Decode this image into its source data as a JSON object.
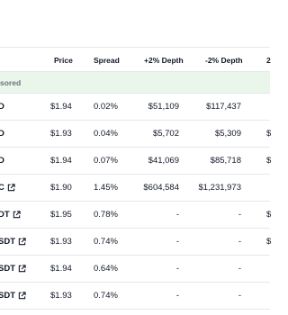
{
  "table": {
    "headers": {
      "price": "Price",
      "spread": "Spread",
      "depth_plus": "+2% Depth",
      "depth_minus": "-2% Depth",
      "cut": "2"
    },
    "sponsored_label": "sored",
    "rows": [
      {
        "pair": "D",
        "link": false,
        "price": "$1.94",
        "spread": "0.02%",
        "depth_plus": "$51,109",
        "depth_minus": "$117,437",
        "cut": ""
      },
      {
        "pair": "D",
        "link": false,
        "price": "$1.93",
        "spread": "0.04%",
        "depth_plus": "$5,702",
        "depth_minus": "$5,309",
        "cut": "$"
      },
      {
        "pair": "D",
        "link": false,
        "price": "$1.94",
        "spread": "0.07%",
        "depth_plus": "$41,069",
        "depth_minus": "$85,718",
        "cut": "$"
      },
      {
        "pair": "C",
        "link": true,
        "price": "$1.90",
        "spread": "1.45%",
        "depth_plus": "$604,584",
        "depth_minus": "$1,231,973",
        "cut": ""
      },
      {
        "pair": "DT",
        "link": true,
        "price": "$1.95",
        "spread": "0.78%",
        "depth_plus": "-",
        "depth_minus": "-",
        "cut": "$"
      },
      {
        "pair": "SDT",
        "link": true,
        "price": "$1.93",
        "spread": "0.74%",
        "depth_plus": "-",
        "depth_minus": "-",
        "cut": "$"
      },
      {
        "pair": "SDT",
        "link": true,
        "price": "$1.94",
        "spread": "0.64%",
        "depth_plus": "-",
        "depth_minus": "-",
        "cut": ""
      },
      {
        "pair": "SDT",
        "link": true,
        "price": "$1.93",
        "spread": "0.74%",
        "depth_plus": "-",
        "depth_minus": "-",
        "cut": ""
      }
    ],
    "icons": {
      "external_link": "external-link-icon"
    }
  }
}
